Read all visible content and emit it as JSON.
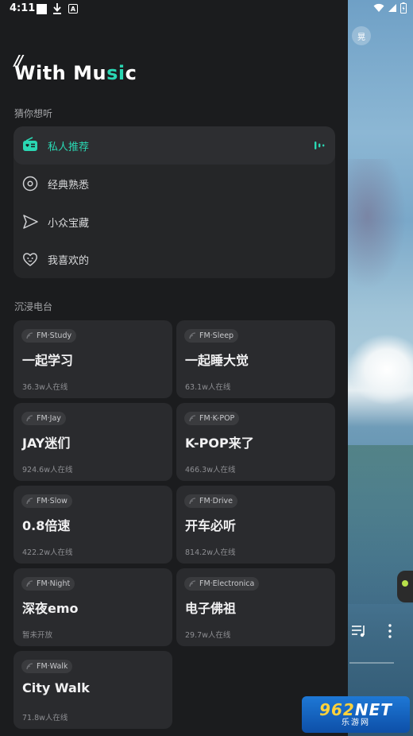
{
  "status_bar": {
    "time": "4:11",
    "download_icon": "download-icon",
    "a_icon_text": "A"
  },
  "background": {
    "badge_text": "晃"
  },
  "logo": {
    "quote": "//",
    "text_part1": "With Mu",
    "text_accent": "si",
    "text_part2": "c",
    "accent_color": "#2ad7b3"
  },
  "guess_section": {
    "title": "猜你想听",
    "items": [
      {
        "label": "私人推荐",
        "icon": "radio-heart-icon",
        "active": true
      },
      {
        "label": "经典熟悉",
        "icon": "disc-icon",
        "active": false
      },
      {
        "label": "小众宝藏",
        "icon": "send-icon",
        "active": false
      },
      {
        "label": "我喜欢的",
        "icon": "heart-face-icon",
        "active": false
      }
    ]
  },
  "radio_section": {
    "title": "沉浸电台",
    "stations": [
      {
        "tag": "FM·Study",
        "name": "一起学习",
        "online": "36.3w人在线"
      },
      {
        "tag": "FM·Sleep",
        "name": "一起睡大觉",
        "online": "63.1w人在线"
      },
      {
        "tag": "FM·Jay",
        "name": "JAY迷们",
        "online": "924.6w人在线"
      },
      {
        "tag": "FM·K-POP",
        "name": "K-POP来了",
        "online": "466.3w人在线"
      },
      {
        "tag": "FM·Slow",
        "name": "0.8倍速",
        "online": "422.2w人在线"
      },
      {
        "tag": "FM·Drive",
        "name": "开车必听",
        "online": "814.2w人在线"
      },
      {
        "tag": "FM·Night",
        "name": "深夜emo",
        "online": "暂未开放"
      },
      {
        "tag": "FM·Electronica",
        "name": "电子佛祖",
        "online": "29.7w人在线"
      },
      {
        "tag": "FM·Walk",
        "name": "City Walk",
        "online": "71.8w人在线"
      }
    ]
  },
  "watermark": {
    "main": "962",
    "net": "NET",
    "sub": "乐游网"
  }
}
